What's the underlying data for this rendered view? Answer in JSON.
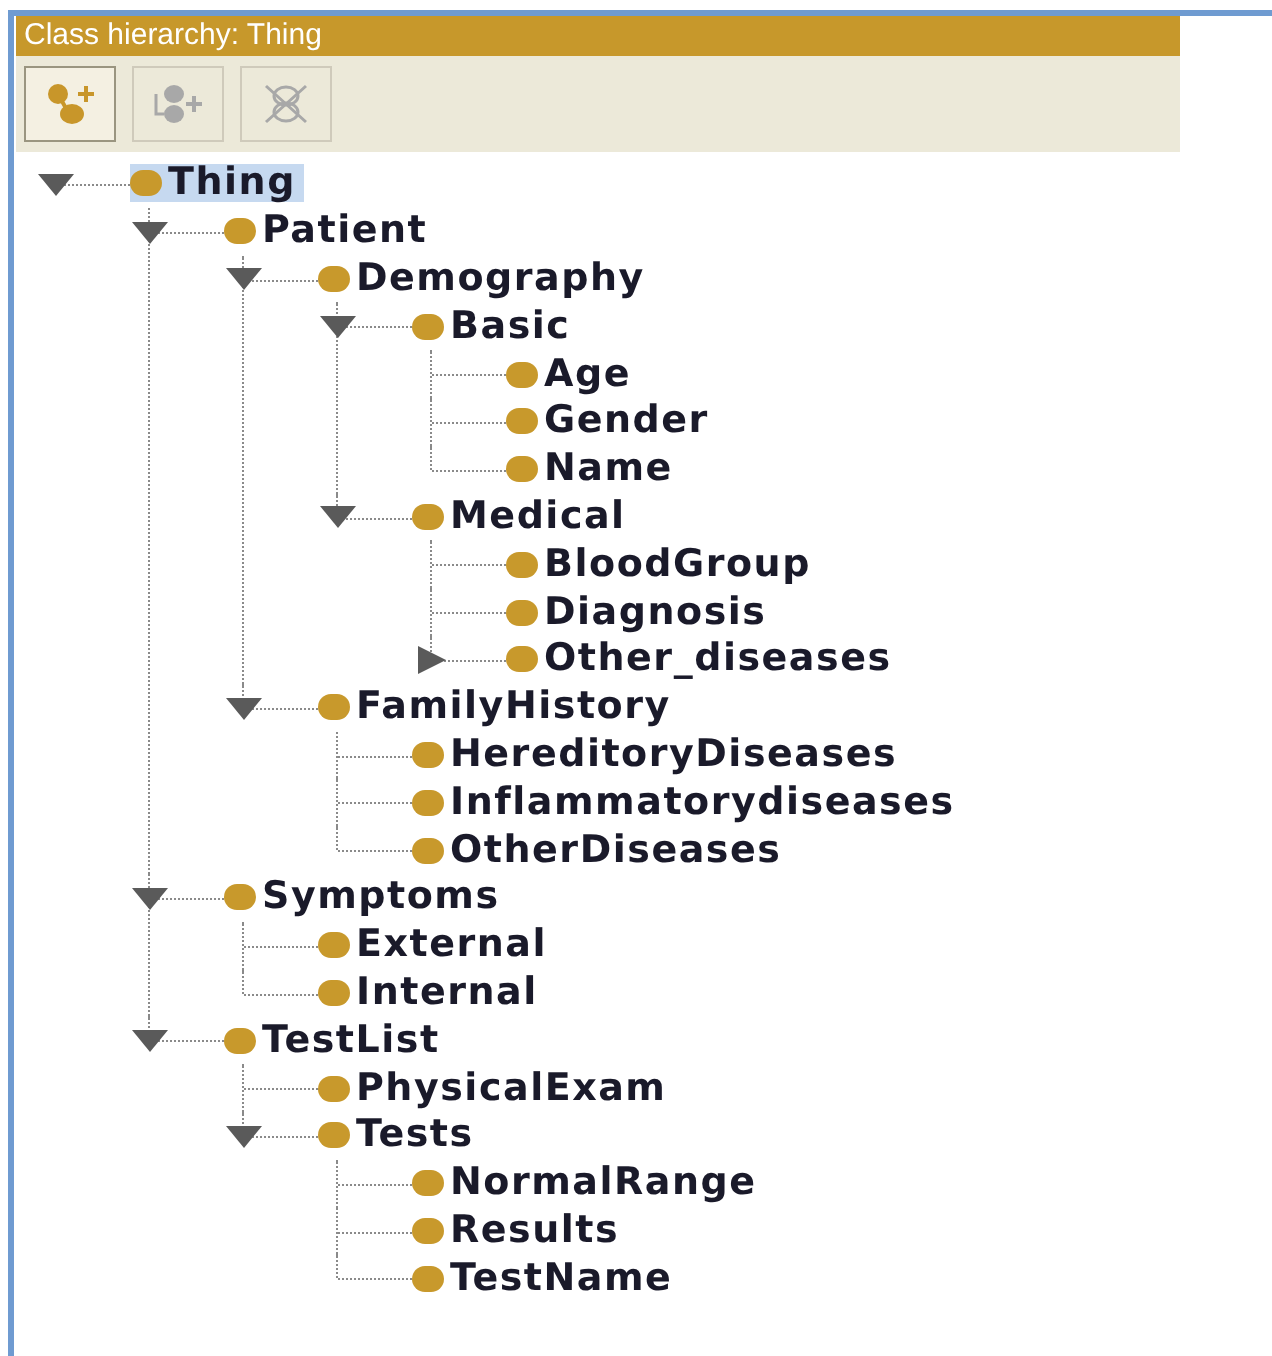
{
  "panel": {
    "title": "Class hierarchy: Thing"
  },
  "toolbar": [
    {
      "kind": "add-subclass",
      "disabled": false
    },
    {
      "kind": "add-sibling",
      "disabled": true
    },
    {
      "kind": "delete",
      "disabled": true
    }
  ],
  "tree": [
    {
      "label": "Thing",
      "selected": true,
      "expanded": true,
      "children": [
        {
          "label": "Patient",
          "selected": false,
          "expanded": true,
          "children": [
            {
              "label": "Demography",
              "selected": false,
              "expanded": true,
              "children": [
                {
                  "label": "Basic",
                  "selected": false,
                  "expanded": true,
                  "children": [
                    {
                      "label": "Age",
                      "selected": false
                    },
                    {
                      "label": "Gender",
                      "selected": false
                    },
                    {
                      "label": "Name",
                      "selected": false
                    }
                  ]
                },
                {
                  "label": "Medical",
                  "selected": false,
                  "expanded": true,
                  "children": [
                    {
                      "label": "BloodGroup",
                      "selected": false
                    },
                    {
                      "label": "Diagnosis",
                      "selected": false
                    },
                    {
                      "label": "Other_diseases",
                      "selected": false,
                      "expanded": false
                    }
                  ]
                }
              ]
            },
            {
              "label": "FamilyHistory",
              "selected": false,
              "expanded": true,
              "children": [
                {
                  "label": "HereditoryDiseases",
                  "selected": false
                },
                {
                  "label": "Inflammatorydiseases",
                  "selected": false
                },
                {
                  "label": "OtherDiseases",
                  "selected": false
                }
              ]
            }
          ]
        },
        {
          "label": "Symptoms",
          "selected": false,
          "expanded": true,
          "children": [
            {
              "label": "External",
              "selected": false
            },
            {
              "label": "Internal",
              "selected": false
            }
          ]
        },
        {
          "label": "TestList",
          "selected": false,
          "expanded": true,
          "children": [
            {
              "label": "PhysicalExam",
              "selected": false
            },
            {
              "label": "Tests",
              "selected": false,
              "expanded": true,
              "children": [
                {
                  "label": "NormalRange",
                  "selected": false
                },
                {
                  "label": "Results",
                  "selected": false
                },
                {
                  "label": "TestName",
                  "selected": false
                }
              ]
            }
          ]
        }
      ]
    }
  ]
}
